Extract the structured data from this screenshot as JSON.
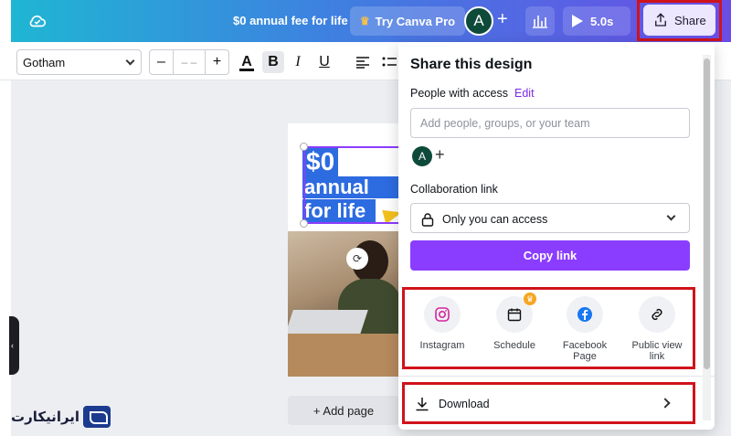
{
  "topbar": {
    "doc_title": "$0 annual fee for life",
    "try_pro": "Try Canva Pro",
    "avatar_initial": "A",
    "add_label": "+",
    "present_time": "5.0s",
    "share_label": "Share",
    "gradient_start": "#1fb6d3",
    "gradient_end": "#6a4de6"
  },
  "toolbar": {
    "font": "Gotham",
    "size_minus": "–",
    "size_value": "– –",
    "size_plus": "+",
    "text_color_icon": "A",
    "bold_icon": "B",
    "italic_icon": "I",
    "underline_icon": "U"
  },
  "canvas": {
    "promo_line1": "$0",
    "promo_line2": "annual fee",
    "promo_line3": "for life",
    "add_page": "+ Add page"
  },
  "watermark": {
    "text": "ایرانیکارت"
  },
  "share_panel": {
    "title": "Share this design",
    "people_label": "People with access",
    "edit_label": "Edit",
    "people_placeholder": "Add people, groups, or your team",
    "avatar_initial": "A",
    "collab_label": "Collaboration link",
    "access_value": "Only you can access",
    "copy_link": "Copy link",
    "options": [
      {
        "label": "Instagram"
      },
      {
        "label": "Schedule"
      },
      {
        "label": "Facebook Page"
      },
      {
        "label": "Public view link"
      }
    ],
    "download": "Download",
    "accent_color": "#8b3dff",
    "highlight_color": "#d0131b"
  }
}
